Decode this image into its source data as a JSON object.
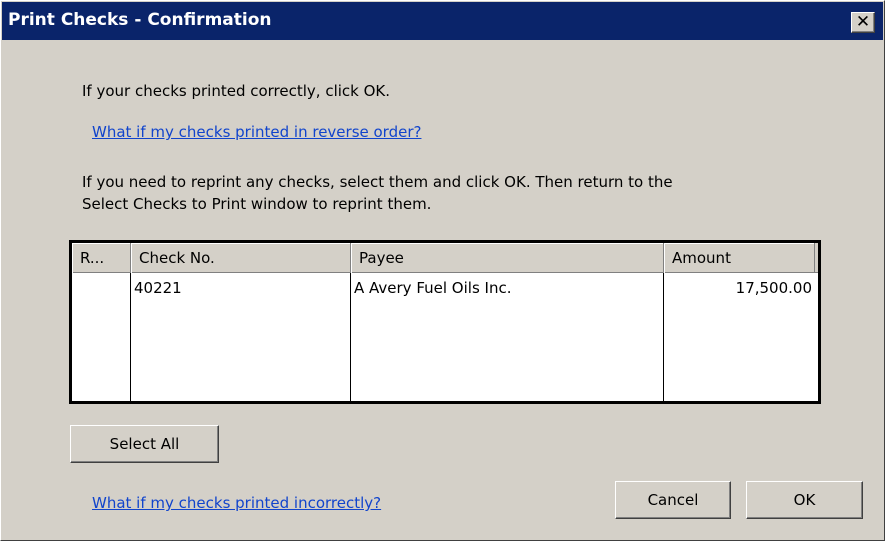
{
  "window": {
    "title": "Print Checks - Confirmation",
    "close_glyph": "✕"
  },
  "instructions": {
    "line1": "If your checks printed correctly, click OK.",
    "link_reverse": "What if my checks printed in reverse order?",
    "reprint_line1": "If you need to reprint any checks, select them and click OK. Then return to the",
    "reprint_line2": "Select Checks to Print window to reprint them."
  },
  "grid": {
    "columns": [
      "R...",
      "Check No.",
      "Payee",
      "Amount"
    ],
    "rows": [
      {
        "reprint": "",
        "check_no": "40221",
        "payee": "A Avery Fuel Oils Inc.",
        "amount": "17,500.00"
      }
    ]
  },
  "buttons": {
    "select_all": "Select All",
    "cancel": "Cancel",
    "ok": "OK"
  },
  "footer": {
    "link_incorrect": "What if my checks printed incorrectly?"
  },
  "colors": {
    "titlebar": "#0a246a",
    "link": "#1144cc",
    "dialog_bg": "#d4d0c8"
  }
}
